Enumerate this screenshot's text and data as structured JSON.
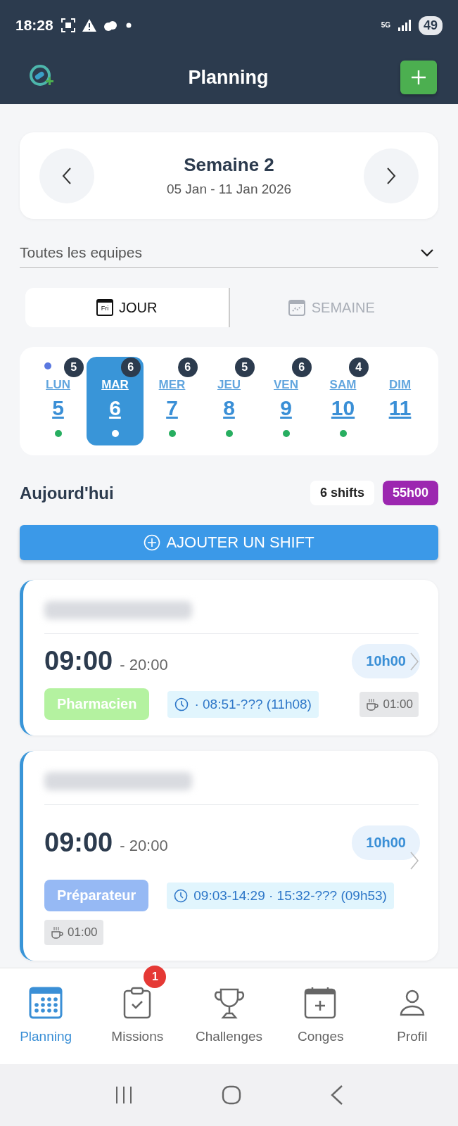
{
  "status_bar": {
    "time": "18:28",
    "network": "5G",
    "battery": "49"
  },
  "header": {
    "title": "Planning"
  },
  "week": {
    "title": "Semaine 2",
    "range": "05 Jan - 11 Jan 2026"
  },
  "team_select": {
    "value": "Toutes les equipes"
  },
  "view_tabs": [
    {
      "label": "JOUR",
      "icon_text": "Fri",
      "selected": true
    },
    {
      "label": "SEMAINE",
      "selected": false
    }
  ],
  "days": [
    {
      "name": "LUN",
      "number": "5",
      "count": "5",
      "has_shifts": true,
      "marker": true,
      "selected": false
    },
    {
      "name": "MAR",
      "number": "6",
      "count": "6",
      "has_shifts": true,
      "marker": false,
      "selected": true
    },
    {
      "name": "MER",
      "number": "7",
      "count": "6",
      "has_shifts": true,
      "marker": false,
      "selected": false
    },
    {
      "name": "JEU",
      "number": "8",
      "count": "5",
      "has_shifts": true,
      "marker": false,
      "selected": false
    },
    {
      "name": "VEN",
      "number": "9",
      "count": "6",
      "has_shifts": true,
      "marker": false,
      "selected": false
    },
    {
      "name": "SAM",
      "number": "10",
      "count": "4",
      "has_shifts": true,
      "marker": false,
      "selected": false
    },
    {
      "name": "DIM",
      "number": "11",
      "has_shifts": false,
      "marker": false,
      "selected": false
    }
  ],
  "summary": {
    "title": "Aujourd'hui",
    "shifts": "6 shifts",
    "hours": "55h00"
  },
  "add_button": {
    "label": "AJOUTER UN SHIFT"
  },
  "shifts": [
    {
      "start": "09:00",
      "end": "- 20:00",
      "duration": "10h00",
      "role": "Pharmacien",
      "color": "#b4f2a0",
      "pointage": "· 08:51-??? (11h08)",
      "break": "01:00"
    },
    {
      "start": "09:00",
      "end": "- 20:00",
      "duration": "10h00",
      "role": "Préparateur",
      "color": "#96b9f4",
      "pointage": "09:03-14:29 · 15:32-??? (09h53)",
      "break": "01:00"
    }
  ],
  "bottom_nav": [
    {
      "label": "Planning",
      "selected": true
    },
    {
      "label": "Missions",
      "badge": "1",
      "selected": false
    },
    {
      "label": "Challenges",
      "selected": false
    },
    {
      "label": "Conges",
      "selected": false
    },
    {
      "label": "Profil",
      "selected": false
    }
  ]
}
